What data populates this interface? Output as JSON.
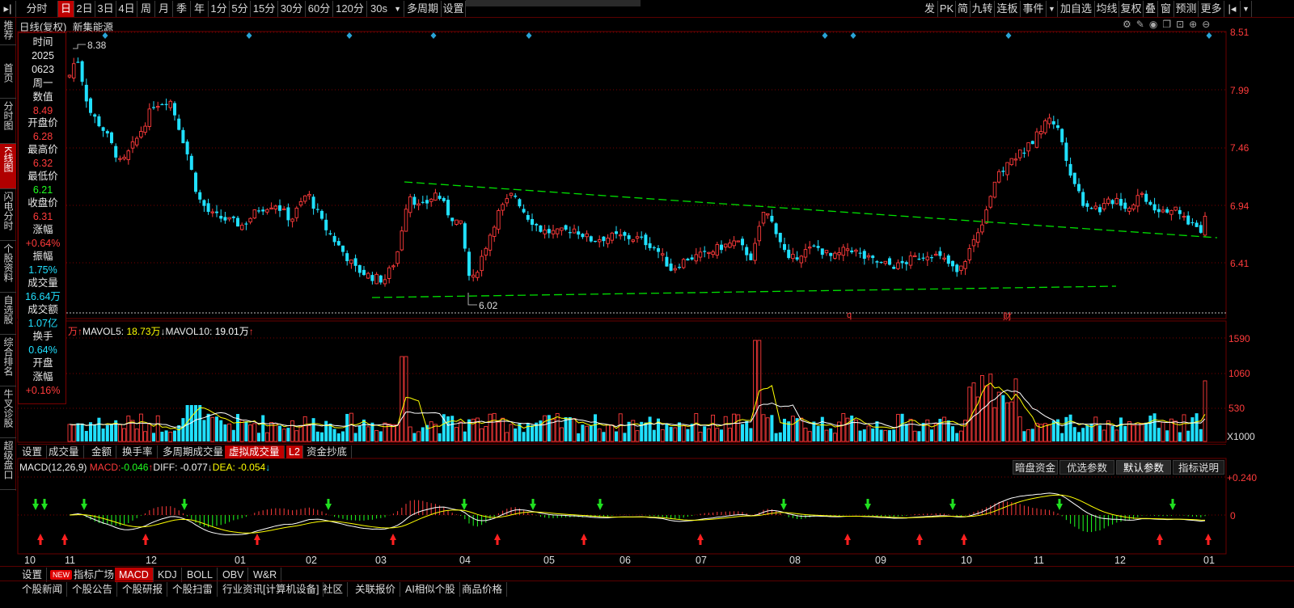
{
  "toolbar": {
    "items": [
      "分时",
      "日",
      "2日",
      "3日",
      "4日",
      "周",
      "月",
      "季",
      "年",
      "1分",
      "5分",
      "15分",
      "30分",
      "60分",
      "120分",
      "30s",
      "多周期",
      "设置"
    ],
    "right_items": [
      "发",
      "PK",
      "简",
      "九转",
      "连板",
      "事件",
      "加自选",
      "均线",
      "复权",
      "叠",
      "窗",
      "预测",
      "更多"
    ]
  },
  "leftnav": [
    "推荐",
    "首页",
    "分时图",
    "K线图",
    "闪电分时",
    "个股资料",
    "自选股",
    "综合排名",
    "牛叉诊股",
    "超级盘口"
  ],
  "chart_title": "日线(复权)",
  "stock_name": "新集能源",
  "info": [
    {
      "label": "时间",
      "value": "2025"
    },
    {
      "label": "",
      "value": "0623"
    },
    {
      "label": "周一",
      "value": ""
    },
    {
      "label": "数值",
      "value": "8.49"
    },
    {
      "label": "开盘价",
      "value": "6.28"
    },
    {
      "label": "最高价",
      "value": "6.32"
    },
    {
      "label": "最低价",
      "value": "6.21"
    },
    {
      "label": "收盘价",
      "value": "6.31"
    },
    {
      "label": "涨幅",
      "value": "+0.64%"
    },
    {
      "label": "振幅",
      "value": "1.75%"
    },
    {
      "label": "成交量",
      "value": "16.64万"
    },
    {
      "label": "成交额",
      "value": "1.07亿"
    },
    {
      "label": "换手",
      "value": "0.64%"
    },
    {
      "label": "开盘",
      "value": ""
    },
    {
      "label": "涨幅",
      "value": "+0.16%"
    }
  ],
  "price_axis": [
    "8.51",
    "7.99",
    "7.46",
    "6.94",
    "6.41"
  ],
  "high_mark": "8.38",
  "low_mark": "6.02",
  "event_marks": {
    "q": "q",
    "cai": "财"
  },
  "volume": {
    "unit": "万",
    "mavol5_label": "MAVOL5:",
    "mavol5": "18.73万",
    "mavol10_label": "MAVOL10:",
    "mavol10": "19.01万",
    "axis": [
      "1590",
      "1060",
      "530"
    ],
    "scale": "X1000"
  },
  "subtabs": [
    "设置",
    "成交量",
    "金额",
    "换手率",
    "多周期成交量",
    "虚拟成交量",
    "L2",
    "资金抄底"
  ],
  "macd": {
    "title": "MACD(12,26,9)",
    "macd_label": "MACD:",
    "macd": "-0.046",
    "diff_label": "DIFF:",
    "diff": "-0.077",
    "dea_label": "DEA:",
    "dea": "-0.054",
    "axis": [
      "+0.240",
      "0"
    ],
    "buttons": [
      "暗盘资金",
      "优选参数",
      "默认参数",
      "指标说明"
    ]
  },
  "months": [
    "10",
    "11",
    "12",
    "01",
    "02",
    "03",
    "04",
    "05",
    "06",
    "07",
    "08",
    "09",
    "10",
    "11",
    "12",
    "01"
  ],
  "indicator_tabs": [
    "设置",
    "NEW",
    "指标广场",
    "MACD",
    "KDJ",
    "BOLL",
    "OBV",
    "W&R"
  ],
  "news_tabs": [
    "个股新闻",
    "个股公告",
    "个股研报",
    "个股扫雷",
    "行业资讯[计算机设备]",
    "社区",
    "关联报价",
    "AI相似个股",
    "商品价格"
  ],
  "colors": {
    "up": "#ff3b3b",
    "down": "#20e0ff",
    "trend": "#00e000",
    "ma5": "#ffff00",
    "ma10": "#ffffff"
  }
}
